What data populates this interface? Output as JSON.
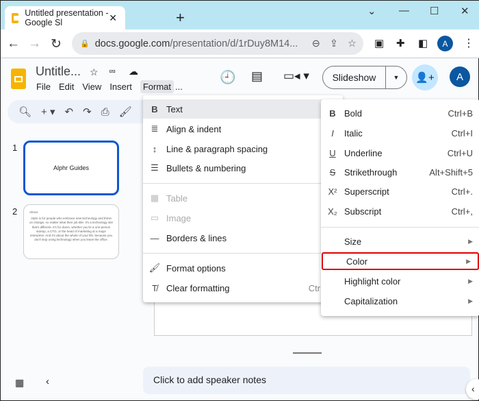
{
  "browser": {
    "tab_title": "Untitled presentation - Google Sl",
    "url_host": "docs.google.com",
    "url_path": "/presentation/d/1rDuy8M14...",
    "profile": "A"
  },
  "app": {
    "doc_title": "Untitle...",
    "menus": [
      "File",
      "Edit",
      "View",
      "Insert",
      "Format",
      "..."
    ],
    "slideshow_label": "Slideshow",
    "avatar": "A"
  },
  "slides": [
    {
      "num": "1",
      "title": "Alphr Guides"
    },
    {
      "num": "2",
      "heading": "About:",
      "body": "Alphr is for people who embrace new technology and thrive on change, no matter what their job title. It's a technology site that's different. It's for doers, whether you're a one-person startup, a CTO, or the head of marketing at a major enterprise. And it's about the whole of your life, because you don't stop using technology when you leave the office."
    }
  ],
  "format_menu": {
    "items": [
      {
        "label": "Text",
        "icon": "B"
      },
      {
        "label": "Align & indent",
        "icon": "≣"
      },
      {
        "label": "Line & paragraph spacing",
        "icon": "↕"
      },
      {
        "label": "Bullets & numbering",
        "icon": "☰"
      },
      {
        "label": "Table",
        "icon": "▦"
      },
      {
        "label": "Image",
        "icon": "▭"
      },
      {
        "label": "Borders & lines",
        "icon": "—"
      },
      {
        "label": "Format options",
        "icon": "🖌"
      },
      {
        "label": "Clear formatting",
        "icon": "T̸",
        "shortcut": "Ctrl"
      }
    ]
  },
  "text_submenu": {
    "items": [
      {
        "label": "Bold",
        "icon": "B",
        "shortcut": "Ctrl+B"
      },
      {
        "label": "Italic",
        "icon": "I",
        "shortcut": "Ctrl+I"
      },
      {
        "label": "Underline",
        "icon": "U",
        "shortcut": "Ctrl+U"
      },
      {
        "label": "Strikethrough",
        "icon": "S",
        "shortcut": "Alt+Shift+5"
      },
      {
        "label": "Superscript",
        "icon": "X²",
        "shortcut": "Ctrl+."
      },
      {
        "label": "Subscript",
        "icon": "X₂",
        "shortcut": "Ctrl+,"
      },
      {
        "label": "Size"
      },
      {
        "label": "Color"
      },
      {
        "label": "Highlight color"
      },
      {
        "label": "Capitalization"
      }
    ],
    "highlight_color": "#e00000"
  },
  "notes_placeholder": "Click to add speaker notes"
}
